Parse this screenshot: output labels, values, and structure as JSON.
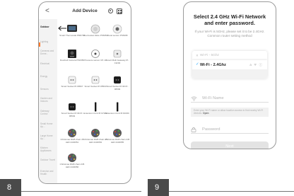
{
  "left_screen": {
    "header": {
      "back": "<",
      "title": "Add Device"
    },
    "categories": [
      {
        "label": "Lighting",
        "active": false
      },
      {
        "label": "Cameras and Dome...",
        "active": false
      },
      {
        "label": "Electrical",
        "active": false
      },
      {
        "label": "Energy",
        "active": false
      },
      {
        "label": "Sensors",
        "active": false
      },
      {
        "label": "Garden and Indoors",
        "active": false
      },
      {
        "label": "Gateway Control",
        "active": false
      },
      {
        "label": "Small Home Ap...",
        "active": false
      },
      {
        "label": "Large Home Ap...",
        "active": false
      },
      {
        "label": "Kitchen Appliances",
        "active": false
      },
      {
        "label": "Outdoor Travel",
        "active": false
      },
      {
        "label": "Exercise and Health",
        "active": false
      }
    ],
    "active_category": "Outdoor",
    "devices": [
      {
        "label": "Smart Thermostat PM6711"
      },
      {
        "label": "Thermostat Valve PS6350"
      },
      {
        "label": "Flood sensor PS6368"
      },
      {
        "label": "Doorbell Camera PS6356"
      },
      {
        "label": "Pressure sensor CP-10"
      },
      {
        "label": "Smart Multi Gateway IP-13202"
      },
      {
        "label": "Smart Socket IP-96507"
      },
      {
        "label": "Smart Socket IP-95503"
      },
      {
        "label": "Smart Socket IP-96 IP-96509"
      },
      {
        "label": "Smart Socket IP-96 IP-95503"
      },
      {
        "label": "Extension Cord IP-97203"
      },
      {
        "label": "Extension Cord IP-82230"
      },
      {
        "label": "Christmas RGB chain 45 LED 2432951"
      },
      {
        "label": "Christmas RGB chain 45 LED 2432952"
      },
      {
        "label": "Christmas RGB chain 245 LED 2432955"
      },
      {
        "label": "Christmas RGB chain 245 LED 2432956"
      }
    ]
  },
  "right_screen": {
    "title": "Select 2.4 GHz Wi-Fi Network and enter password.",
    "subtitle": "If your Wi-Fi is 5GHz, please set it to be 2.4GHz. Common router setting method",
    "networks": [
      {
        "mark": "✕",
        "name": "Wi-Fi - 5Ghz",
        "state": "disabled"
      },
      {
        "mark": "✓",
        "name": "Wi-Fi - 2.4Ghz",
        "state": "selected",
        "icons": "a ᯤ ⓘ"
      },
      {
        "mark": "",
        "name": "",
        "state": "empty"
      }
    ],
    "wifi_name_label": "Wi-Fi Name",
    "hint_text": "Enter your Wi-Fi name or allow location access to find nearby Wi-Fi devices.",
    "hint_link": "Open",
    "password_label": "Password",
    "next_label": "Next"
  },
  "steps": [
    "8",
    "9"
  ]
}
